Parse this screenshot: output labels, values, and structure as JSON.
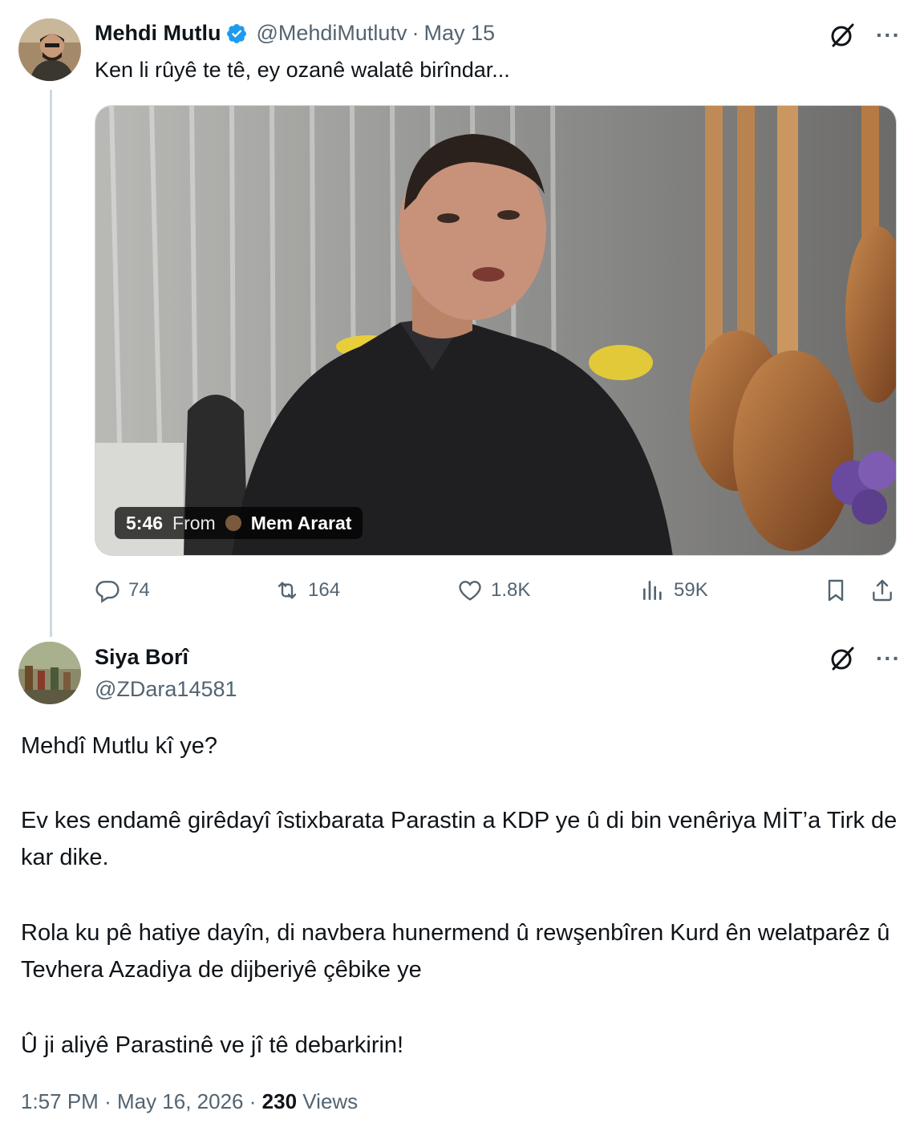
{
  "parent_tweet": {
    "display_name": "Mehdi Mutlu",
    "handle": "@MehdiMutlutv",
    "separator": "·",
    "date": "May 15",
    "text": "Ken li rûyê te tê, ey ozanê walatê birîndar...",
    "video": {
      "duration": "5:46",
      "from_label": "From",
      "source_name": "Mem Ararat"
    },
    "stats": {
      "replies": "74",
      "reposts": "164",
      "likes": "1.8K",
      "views": "59K"
    }
  },
  "reply_tweet": {
    "display_name": "Siya Borî",
    "handle": "@ZDara14581",
    "paragraphs": [
      "Mehdî Mutlu kî ye?",
      "Ev kes endamê girêdayî îstixbarata Parastin a KDP ye û di bin venêriya MİT’a Tirk de kar dike.",
      "Rola ku pê hatiye dayîn, di navbera hunermend û rewşenbîren Kurd ên welatparêz û Tevhera Azadiya de dijberiyê çêbike ye",
      "Û ji aliyê Parastinê ve jî tê debarkirin!"
    ],
    "time": "1:57 PM",
    "separator": "·",
    "date": "May 16, 2026",
    "views_count": "230",
    "views_label": "Views"
  },
  "icons": {
    "verified": "verified-badge-icon",
    "grok": "grok-icon",
    "more": "more-icon",
    "reply": "reply-icon",
    "repost": "repost-icon",
    "like": "like-icon",
    "views": "views-icon",
    "bookmark": "bookmark-icon",
    "share": "share-icon"
  },
  "colors": {
    "text": "#0f1419",
    "secondary": "#536471",
    "verified": "#1d9bf0",
    "thread_line": "#cfd9de"
  }
}
